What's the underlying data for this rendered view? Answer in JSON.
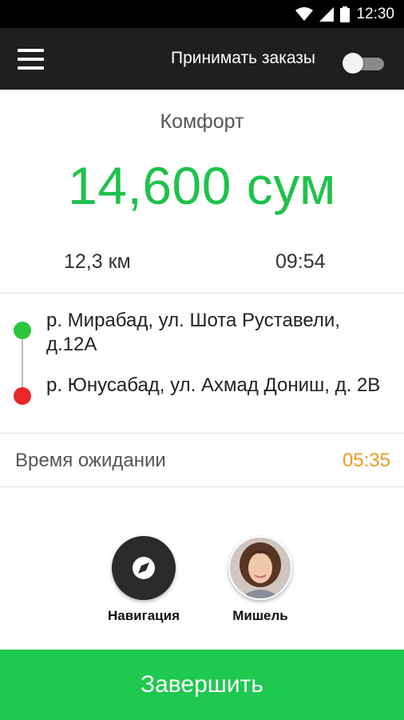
{
  "status_bar": {
    "time": "12:30",
    "icons": [
      "wifi-icon",
      "signal-icon",
      "battery-icon"
    ]
  },
  "app_bar": {
    "menu_icon": "hamburger-menu-icon",
    "accept_orders_label": "Принимать заказы",
    "accept_orders_toggle_on": false
  },
  "trip": {
    "tariff": "Комфорт",
    "price": "14,600 сум",
    "distance": "12,3 км",
    "duration": "09:54"
  },
  "route": {
    "from": "р. Мирабад, ул. Шота Руставели, д.12А",
    "to": "р. Юнусабад, ул. Ахмад Дониш, д. 2В"
  },
  "waiting": {
    "label": "Время ожидании",
    "time": "05:35"
  },
  "actions": {
    "navigation_label": "Навигация",
    "navigation_icon": "compass-icon",
    "contact_label": "Мишель",
    "contact_icon": "avatar"
  },
  "finish_button": "Завершить",
  "colors": {
    "accent_green": "#1fc84e",
    "price_green": "#1ec24b",
    "wait_orange": "#f09a21",
    "route_start": "#2ac63d",
    "route_end": "#e8262b",
    "app_bar": "#1f1f1f"
  }
}
